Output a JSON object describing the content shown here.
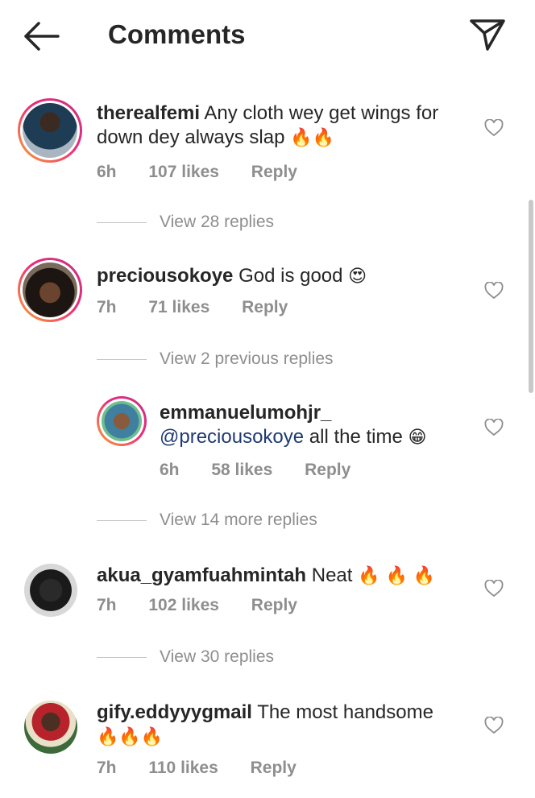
{
  "header": {
    "title": "Comments"
  },
  "comments": [
    {
      "username": "therealfemi",
      "text": "Any cloth wey get wings for down dey always slap",
      "emoji": "🔥🔥",
      "time": "6h",
      "likes": "107 likes",
      "reply": "Reply",
      "view": "View 28 replies"
    },
    {
      "username": "preciousokoye",
      "text": "God is good",
      "emoji": "😍",
      "time": "7h",
      "likes": "71 likes",
      "reply": "Reply",
      "view": "View 2 previous replies"
    },
    {
      "username": "akua_gyamfuahmintah",
      "text": "Neat",
      "emoji": "🔥 🔥 🔥",
      "time": "7h",
      "likes": "102 likes",
      "reply": "Reply",
      "view": "View 30 replies"
    },
    {
      "username": "gify.eddyyygmail",
      "text": "The most handsome",
      "emoji": "🔥🔥🔥",
      "time": "7h",
      "likes": "110 likes",
      "reply": "Reply"
    }
  ],
  "reply": {
    "username": "emmanuelumohjr_",
    "mention": "@preciousokoye",
    "text": "all the time",
    "emoji": "😁",
    "time": "6h",
    "likes": "58 likes",
    "reply": "Reply",
    "view": "View 14 more replies"
  },
  "colors": {
    "ring_start": "#f9a334",
    "ring_end": "#c13584",
    "meta": "#8e8e8e",
    "mention": "#1f3b70"
  },
  "icons": {
    "back": "arrow-left-icon",
    "send": "paper-plane-icon",
    "like": "heart-outline-icon"
  }
}
